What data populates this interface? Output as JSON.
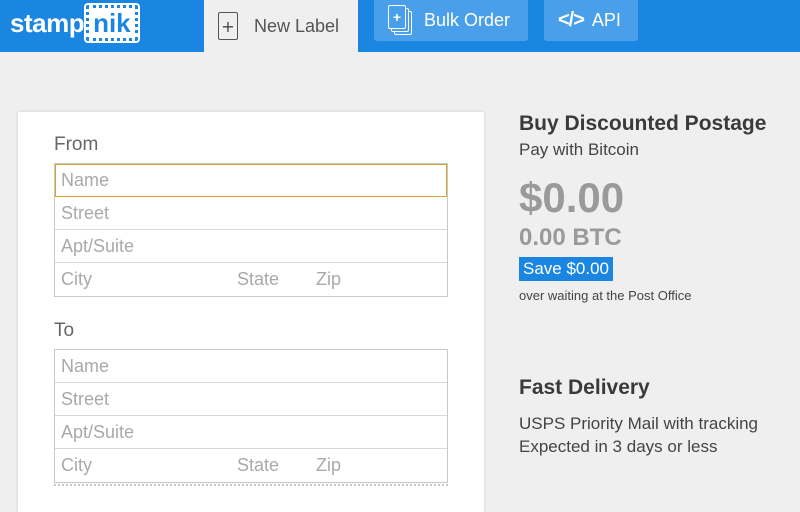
{
  "brand": {
    "logo_part1": "stamp",
    "logo_part2": "nik"
  },
  "nav": {
    "new_label": {
      "icon": "plus-icon",
      "icon_glyph": "+",
      "label": "New Label"
    },
    "bulk_order": {
      "icon": "stacked-pages-plus-icon",
      "icon_glyph": "+",
      "label": "Bulk Order"
    },
    "api": {
      "icon": "code-icon",
      "icon_glyph": "</>",
      "label": "API"
    }
  },
  "form": {
    "from": {
      "title": "From",
      "name_placeholder": "Name",
      "street_placeholder": "Street",
      "apt_placeholder": "Apt/Suite",
      "city_placeholder": "City",
      "state_placeholder": "State",
      "zip_placeholder": "Zip"
    },
    "to": {
      "title": "To",
      "name_placeholder": "Name",
      "street_placeholder": "Street",
      "apt_placeholder": "Apt/Suite",
      "city_placeholder": "City",
      "state_placeholder": "State",
      "zip_placeholder": "Zip"
    }
  },
  "promo": {
    "title": "Buy Discounted Postage",
    "subtitle": "Pay with Bitcoin",
    "price": "$0.00",
    "btc": "0.00 BTC",
    "save_label": "Save $0.00",
    "save_note": "over waiting at the Post Office"
  },
  "delivery": {
    "title": "Fast Delivery",
    "line1": "USPS Priority Mail with tracking",
    "line2": "Expected in 3 days or less"
  },
  "colors": {
    "brand_blue": "#1a86e2",
    "nav_button": "#4a9fea",
    "focus_outline": "#d4a52a"
  }
}
